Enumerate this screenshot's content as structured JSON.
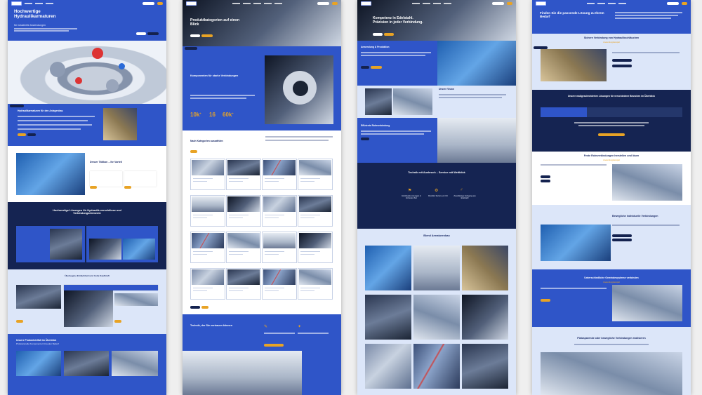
{
  "page1": {
    "hero": {
      "title": "Hochwertige Hydraulikarmaturen",
      "subtitle": "für industrielle Anwendungen"
    },
    "intro": {
      "badge": "",
      "heading": "Hydraulikarmaturen für den Anlagenbau"
    },
    "tab_heading": "Dreuer Tätikon – Ihr Vorteil",
    "dark_section": {
      "title": "Hochwertige Lösungen für Hydraulik-verschlüsse und Verbindungselemente"
    },
    "products_heading": "Überlegene Einfachheit und hohe Kaufkraft",
    "bottom_section": {
      "title": "Unsere Produktvielfalt im Überblick",
      "subtitle": "Professionelle Komponenten für jeden Bedarf"
    }
  },
  "page2": {
    "hero": {
      "title": "Produktkategorien auf einen Blick"
    },
    "feature_title": "Komponenten für starke Verbindungen",
    "stats": [
      {
        "value": "10k",
        "suffix": "+"
      },
      {
        "value": "16",
        "suffix": ""
      },
      {
        "value": "60k",
        "suffix": "+"
      }
    ],
    "category_heading": "Nach Kategorien auswählen",
    "bottom_title": "Technik, der Sie vertrauen können"
  },
  "page3": {
    "hero": {
      "title": "Kompetenz in Edelstahl. Präzision in jeder Verbindung."
    },
    "section1_heading": "Anwendung & Produktion",
    "section2_heading": "Unsere Vision",
    "section3_heading": "Effiziente Rohrverbindung",
    "service_title": "Technik mit Ausbruch – Service mit Weitblick",
    "service_items": [
      "Individuelle Lösungen in kürzester Zeit",
      "Flexibler Service vor Ort",
      "Zuverlässige Fertigung aus Edelstahl"
    ],
    "gallery_heading": "Blend Armaturenbau"
  },
  "page4": {
    "hero": {
      "title": "Finden Sie die passende Lösung zu Ihrem Bedarf"
    },
    "section1": {
      "title": "Sichere Verbindung von Hydraulikschläuchen",
      "tag": "Anwendungsbeispiel"
    },
    "tabs_title": "Unsere maßgeschneiderten Lösungen für verschiedene Branchen im Überblick",
    "section2": {
      "title": "Feste Rohrverbindungen herstellen und lösen",
      "tag": "Anwendungsbeispiel"
    },
    "section3": {
      "title": "Bewegliche Individuelle Verbindungen"
    },
    "section4": {
      "title": "Unterschiedliche Gewindesysteme verbinden",
      "tag": "Anwendungsbeispiel"
    },
    "section5": {
      "title": "Platzsparende oder bewegliche Verbindungen realisieren"
    }
  },
  "colors": {
    "primary_blue": "#2f55c8",
    "dark_navy": "#152452",
    "light_blue": "#dce6f9",
    "accent_orange": "#e8a325"
  }
}
